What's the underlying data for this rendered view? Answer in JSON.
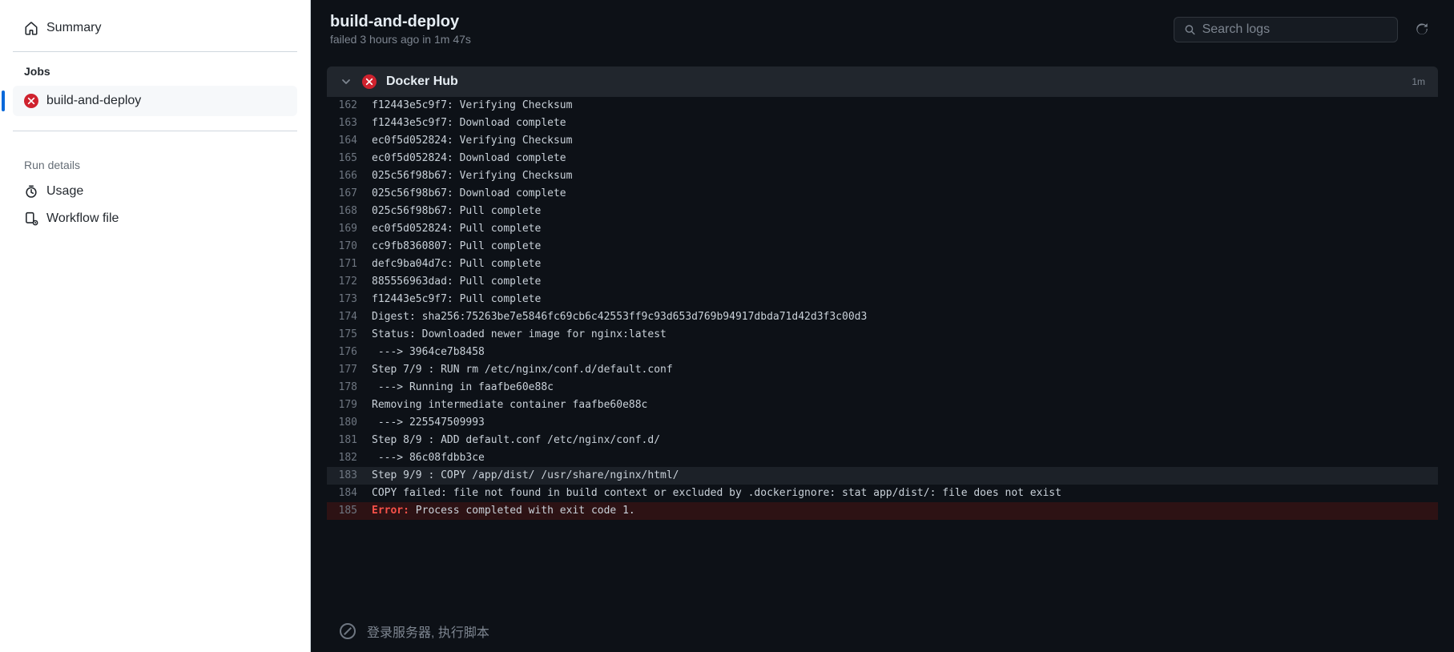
{
  "sidebar": {
    "summary_label": "Summary",
    "jobs_heading": "Jobs",
    "job_name": "build-and-deploy",
    "run_details_heading": "Run details",
    "usage_label": "Usage",
    "workflow_file_label": "Workflow file"
  },
  "header": {
    "title": "build-and-deploy",
    "subtitle": "failed 3 hours ago in 1m 47s",
    "search_placeholder": "Search logs"
  },
  "step": {
    "title": "Docker Hub",
    "duration": "1m"
  },
  "closed_step": {
    "title": "登录服务器, 执行脚本"
  },
  "logs": [
    {
      "n": 162,
      "t": "f12443e5c9f7: Verifying Checksum"
    },
    {
      "n": 163,
      "t": "f12443e5c9f7: Download complete"
    },
    {
      "n": 164,
      "t": "ec0f5d052824: Verifying Checksum"
    },
    {
      "n": 165,
      "t": "ec0f5d052824: Download complete"
    },
    {
      "n": 166,
      "t": "025c56f98b67: Verifying Checksum"
    },
    {
      "n": 167,
      "t": "025c56f98b67: Download complete"
    },
    {
      "n": 168,
      "t": "025c56f98b67: Pull complete"
    },
    {
      "n": 169,
      "t": "ec0f5d052824: Pull complete"
    },
    {
      "n": 170,
      "t": "cc9fb8360807: Pull complete"
    },
    {
      "n": 171,
      "t": "defc9ba04d7c: Pull complete"
    },
    {
      "n": 172,
      "t": "885556963dad: Pull complete"
    },
    {
      "n": 173,
      "t": "f12443e5c9f7: Pull complete"
    },
    {
      "n": 174,
      "t": "Digest: sha256:75263be7e5846fc69cb6c42553ff9c93d653d769b94917dbda71d42d3f3c00d3"
    },
    {
      "n": 175,
      "t": "Status: Downloaded newer image for nginx:latest"
    },
    {
      "n": 176,
      "t": " ---> 3964ce7b8458"
    },
    {
      "n": 177,
      "t": "Step 7/9 : RUN rm /etc/nginx/conf.d/default.conf"
    },
    {
      "n": 178,
      "t": " ---> Running in faafbe60e88c"
    },
    {
      "n": 179,
      "t": "Removing intermediate container faafbe60e88c"
    },
    {
      "n": 180,
      "t": " ---> 225547509993"
    },
    {
      "n": 181,
      "t": "Step 8/9 : ADD default.conf /etc/nginx/conf.d/"
    },
    {
      "n": 182,
      "t": " ---> 86c08fdbb3ce"
    },
    {
      "n": 183,
      "t": "Step 9/9 : COPY /app/dist/ /usr/share/nginx/html/",
      "hl": true
    },
    {
      "n": 184,
      "t": "COPY failed: file not found in build context or excluded by .dockerignore: stat app/dist/: file does not exist"
    },
    {
      "n": 185,
      "t": "Process completed with exit code 1.",
      "err": true,
      "errlabel": "Error: "
    }
  ]
}
